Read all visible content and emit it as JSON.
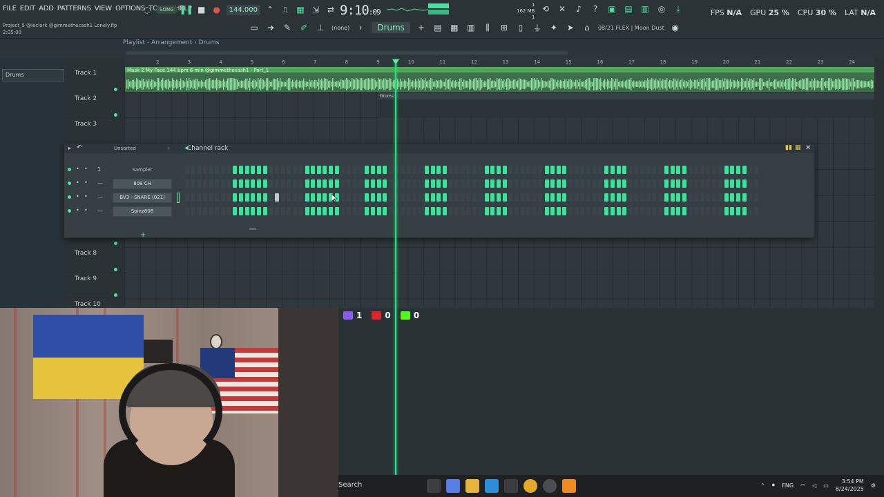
{
  "menu": [
    "FILE",
    "EDIT",
    "ADD",
    "PATTERNS",
    "VIEW",
    "OPTIONS",
    "TOOLS",
    "HELP"
  ],
  "project": {
    "line1": "Project_5 @leclark @gimmethecash1 Lonely.flp",
    "line2": "2:05:00"
  },
  "transport": {
    "song_label": "SONG",
    "tempo": "144.000",
    "time": "9:10",
    "time_sub": ":09"
  },
  "memory": {
    "mb": "162 MB",
    "voices": "1",
    "top": "1"
  },
  "stats": {
    "fps_label": "FPS",
    "fps_value": "N/A",
    "gpu_label": "GPU",
    "gpu_value": "25 %",
    "cpu_label": "CPU",
    "cpu_value": "30 %",
    "lat_label": "LAT",
    "lat_value": "N/A"
  },
  "toolbar2": {
    "none_label": "(none)",
    "pattern": "Drums",
    "hint": "08/21  FLEX | Moon Dust"
  },
  "browser": {
    "selected": "Drums"
  },
  "playlist": {
    "breadcrumb": "Playlist - Arrangement  ›  Drums"
  },
  "timeline": [
    "2",
    "3",
    "4",
    "5",
    "6",
    "7",
    "8",
    "9",
    "10",
    "11",
    "12",
    "13",
    "14",
    "15",
    "16",
    "17",
    "18",
    "19",
    "20",
    "21",
    "22",
    "23",
    "24"
  ],
  "tracks": [
    {
      "name": "Track 1"
    },
    {
      "name": "Track 2"
    },
    {
      "name": "Track 3"
    },
    {
      "name": "Track 8"
    },
    {
      "name": "Track 9"
    },
    {
      "name": "Track 10"
    }
  ],
  "clips": {
    "audio": "Mask 2 My Face 144 bpm 6 min @gimmethecash1 - Part_1",
    "pattern": "Drums"
  },
  "rack": {
    "title": "Channel rack",
    "filter": "Unsorted",
    "channels": [
      {
        "num": "1",
        "name": "Sampler"
      },
      {
        "num": "—",
        "name": "808 CH"
      },
      {
        "num": "—",
        "name": "BV3 - SNARE (021)"
      },
      {
        "num": "—",
        "name": "Spinz808"
      }
    ],
    "pattern_rows": [
      [
        0,
        0,
        0,
        0,
        0,
        0,
        0,
        0,
        1,
        1,
        1,
        1,
        1,
        1,
        0,
        0,
        0,
        0,
        0,
        0,
        1,
        1,
        1,
        1,
        1,
        1
      ],
      [
        0,
        0,
        0,
        0,
        0,
        0,
        0,
        0,
        1,
        1,
        1,
        1,
        1,
        1,
        0,
        0,
        0,
        0,
        0,
        0,
        1,
        1,
        1,
        1,
        1,
        1
      ],
      [
        0,
        0,
        0,
        0,
        0,
        0,
        0,
        0,
        1,
        1,
        1,
        1,
        1,
        1,
        0,
        2,
        0,
        0,
        0,
        0,
        1,
        1,
        1,
        1,
        1,
        1
      ],
      [
        0,
        0,
        0,
        0,
        0,
        0,
        0,
        0,
        1,
        1,
        1,
        1,
        1,
        1,
        0,
        0,
        0,
        0,
        0,
        0,
        1,
        1,
        1,
        1,
        1,
        1
      ]
    ]
  },
  "counters": {
    "twitch": "1",
    "youtube": "0",
    "kick": "0"
  },
  "taskbar": {
    "search": "Search",
    "lang": "ENG",
    "time": "3:54 PM",
    "date": "8/24/2025"
  },
  "colors": {
    "accent": "#38e39a",
    "playhead": "#26e07e",
    "bg": "#2a3236"
  }
}
